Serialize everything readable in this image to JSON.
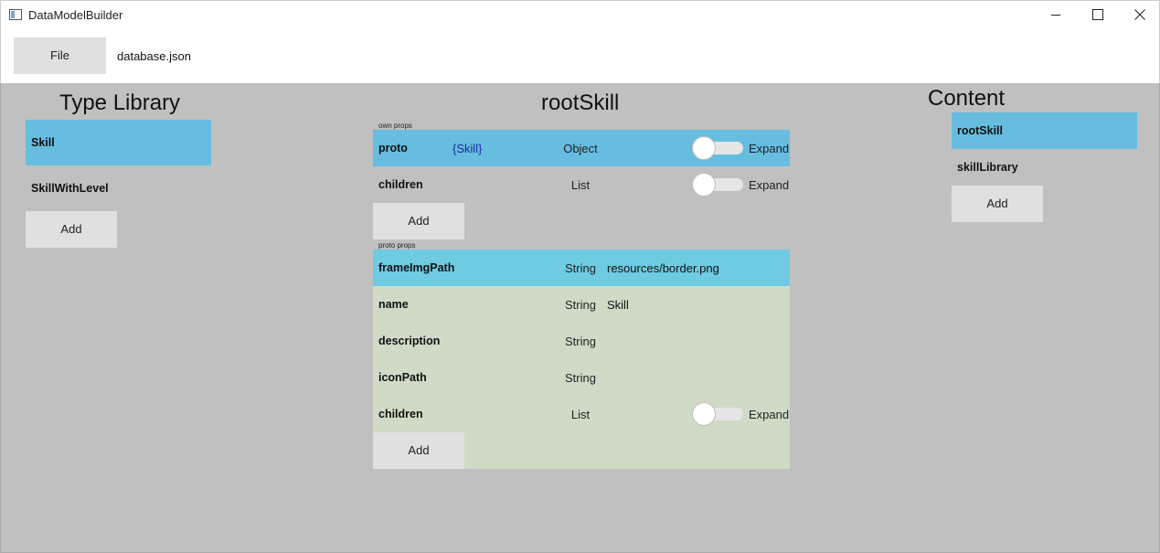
{
  "window": {
    "title": "DataModelBuilder"
  },
  "toolbar": {
    "file_label": "File",
    "file_name": "database.json"
  },
  "type_library": {
    "title": "Type Library",
    "items": [
      {
        "label": "Skill",
        "selected": true
      },
      {
        "label": "SkillWithLevel",
        "selected": false
      }
    ],
    "add_label": "Add"
  },
  "editor": {
    "title": "rootSkill",
    "own_props_label": "own props",
    "own_props": [
      {
        "name": "proto",
        "proto_type": "{Skill}",
        "type": "Object",
        "expand_label": "Expand"
      },
      {
        "name": "children",
        "type": "List",
        "expand_label": "Expand"
      }
    ],
    "own_add_label": "Add",
    "proto_props_label": "proto props",
    "proto_props": [
      {
        "name": "frameImgPath",
        "type": "String",
        "value": "resources/border.png"
      },
      {
        "name": "name",
        "type": "String",
        "value": "Skill"
      },
      {
        "name": "description",
        "type": "String",
        "value": ""
      },
      {
        "name": "iconPath",
        "type": "String",
        "value": ""
      },
      {
        "name": "children",
        "type": "List",
        "expand_label": "Expand"
      }
    ],
    "proto_add_label": "Add"
  },
  "content": {
    "title": "Content",
    "items": [
      {
        "label": "rootSkill",
        "selected": true
      },
      {
        "label": "skillLibrary",
        "selected": false
      }
    ],
    "add_label": "Add"
  },
  "colors": {
    "selected": "#67bde0",
    "proto_bg": "#cfdbc7",
    "panel_bg": "#c0c0c0",
    "button_bg": "#e0e0e0"
  }
}
